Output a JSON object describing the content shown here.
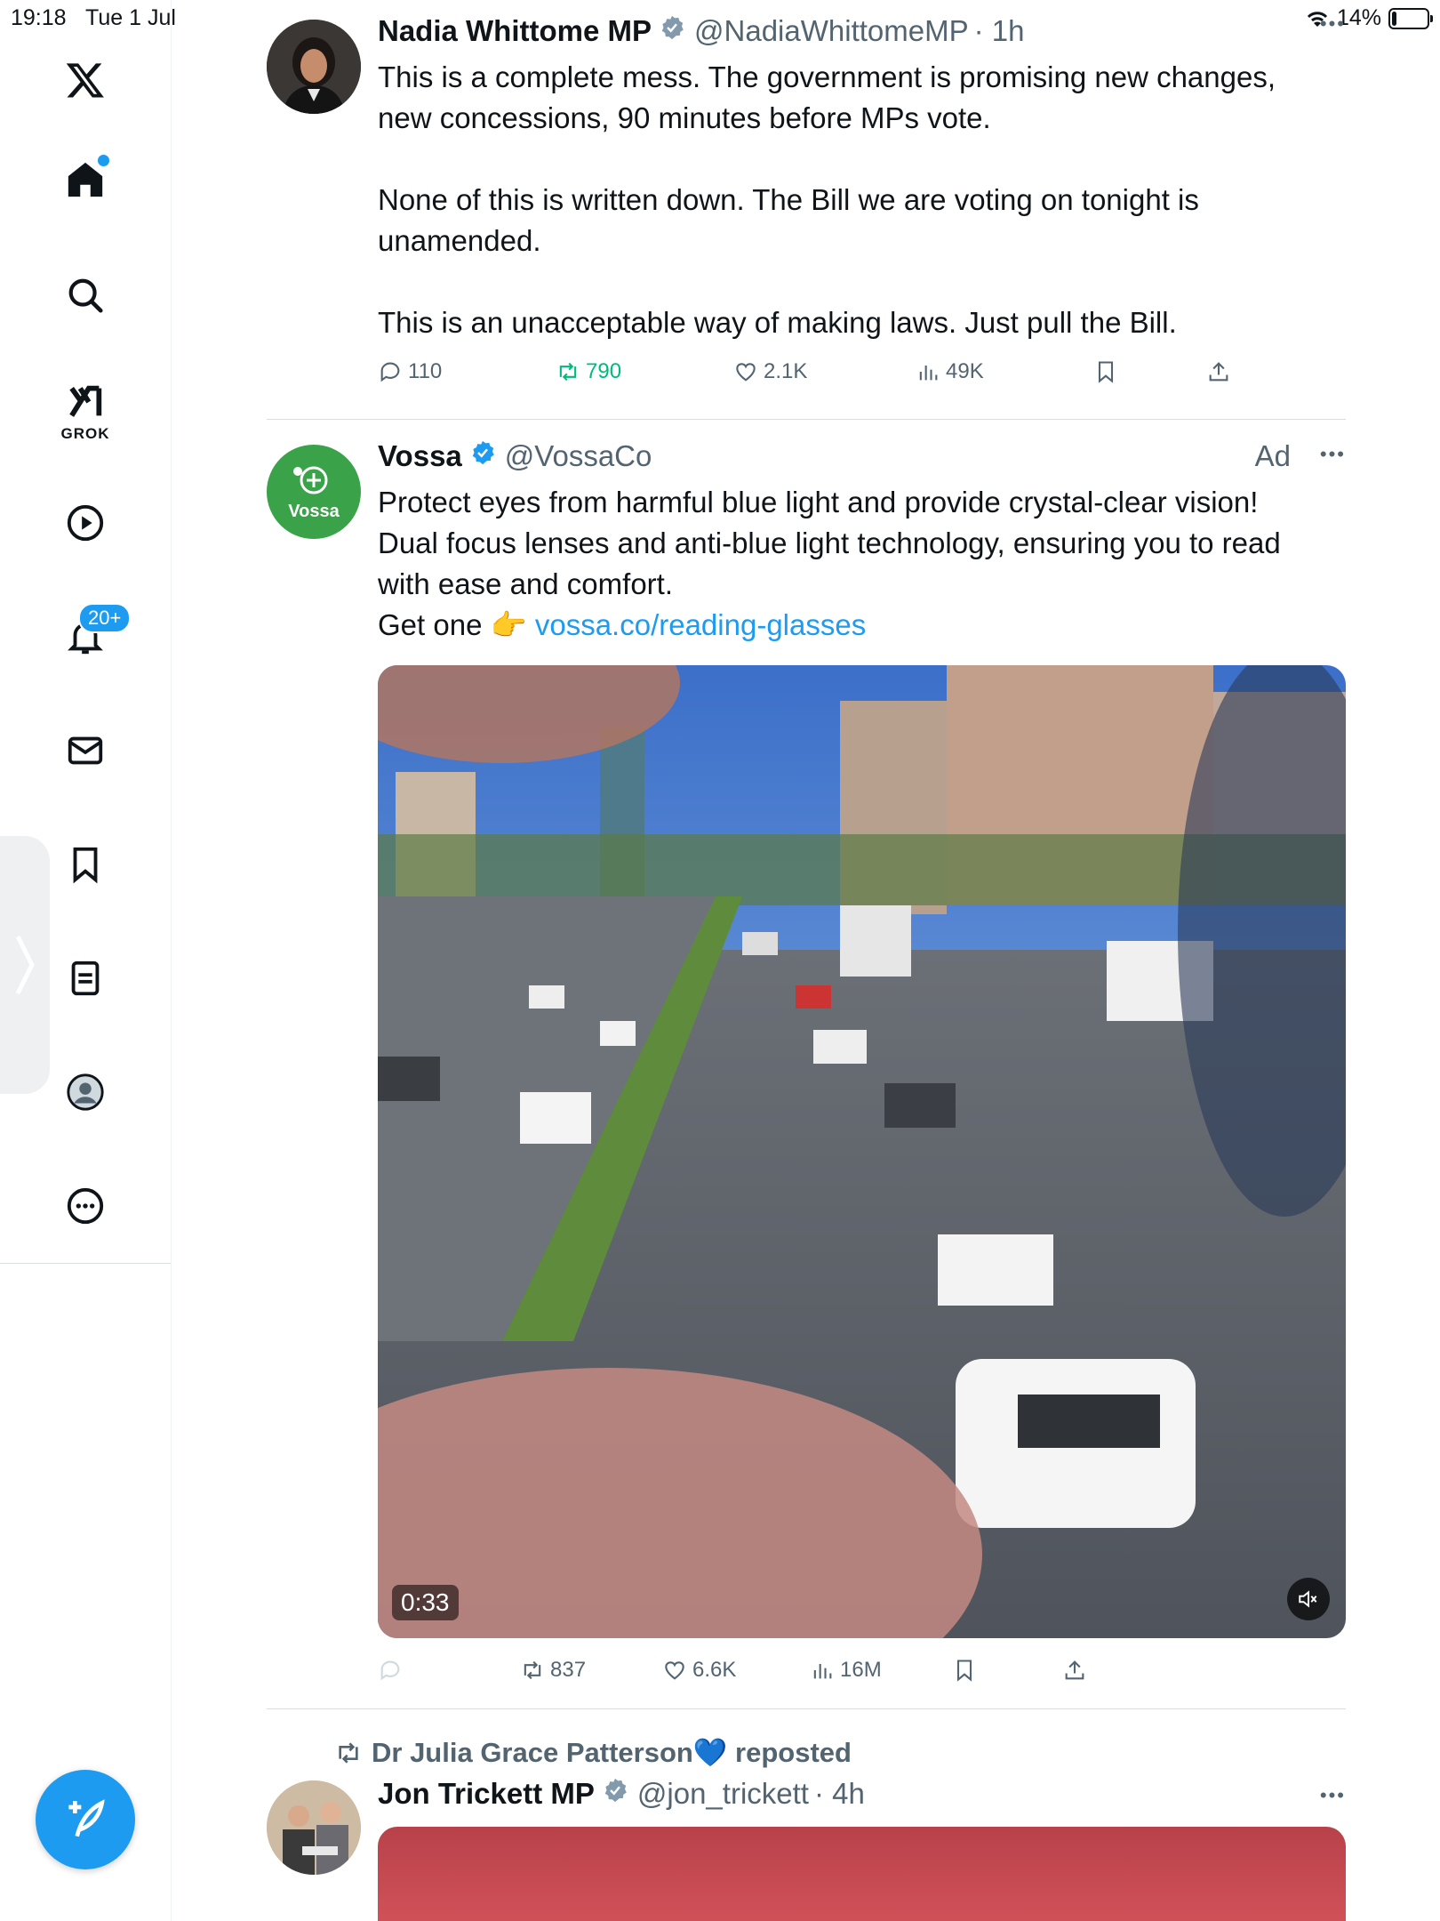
{
  "status_bar": {
    "time": "19:18",
    "date": "Tue 1 Jul",
    "battery": "14%",
    "battery_fraction": 0.14
  },
  "sidebar": {
    "grok_label": "GROK",
    "notifications_badge": "20+"
  },
  "tweets": [
    {
      "name": "Nadia Whittome MP",
      "handle": "@NadiaWhittomeMP",
      "time": "· 1h",
      "paragraphs": [
        "This is a complete mess. The government is promising new changes, new concessions, 90 minutes before MPs vote.",
        "None of this is written down. The Bill we are voting on tonight is unamended.",
        "This is an unacceptable way of making laws. Just pull the Bill."
      ],
      "replies": "110",
      "reposts": "790",
      "likes": "2.1K",
      "views": "49K"
    },
    {
      "name": "Vossa",
      "handle": "@VossaCo",
      "ad_label": "Ad",
      "avatar_text": "Vossa",
      "text_1": "Protect eyes from harmful blue light and provide crystal-clear vision! Dual focus lenses and anti-blue light technology, ensuring you to read with ease and comfort.",
      "text_2": "Get one 👉 ",
      "link": "vossa.co/reading-glasses",
      "video_duration": "0:33",
      "reposts": "837",
      "likes": "6.6K",
      "views": "16M"
    },
    {
      "reposted_by": "Dr Julia Grace Patterson💙 reposted",
      "name": "Jon Trickett MP",
      "handle": "@jon_trickett",
      "time": "· 4h"
    }
  ],
  "colors": {
    "accent": "#1d9bf0",
    "repost_green": "#00ba7c",
    "muted": "#536471",
    "vossa_green": "#3aa34a"
  }
}
